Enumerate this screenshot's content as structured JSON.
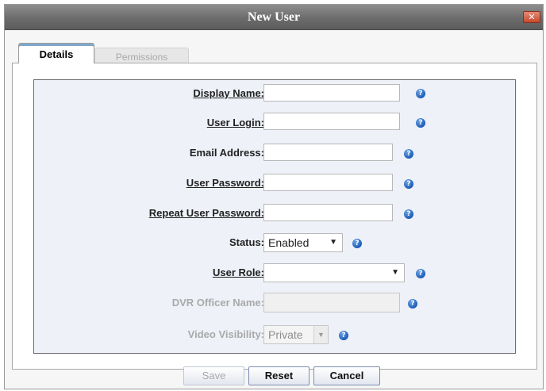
{
  "dialog": {
    "title": "New User",
    "close_glyph": "✕"
  },
  "tabs": [
    {
      "label": "Details",
      "active": true
    },
    {
      "label": "Permissions",
      "active": false
    }
  ],
  "form": {
    "display_name": {
      "label": "Display Name:",
      "value": ""
    },
    "user_login": {
      "label": "User Login:",
      "value": ""
    },
    "email_address": {
      "label": "Email Address:",
      "value": ""
    },
    "user_password": {
      "label": "User Password:",
      "value": ""
    },
    "repeat_password": {
      "label": "Repeat User Password:",
      "value": ""
    },
    "status": {
      "label": "Status:",
      "selected": "Enabled"
    },
    "user_role": {
      "label": "User Role:",
      "selected": ""
    },
    "dvr_officer_name": {
      "label": "DVR Officer Name:",
      "value": ""
    },
    "video_visibility": {
      "label": "Video Visibility:",
      "selected": "Private"
    }
  },
  "help_glyph": "?",
  "icons": {
    "help": "help-icon",
    "dropdown": "chevron-down-icon",
    "close": "close-icon"
  },
  "buttons": {
    "save": "Save",
    "reset": "Reset",
    "cancel": "Cancel"
  },
  "colors": {
    "title_bar": "#6c6c6c",
    "form_bg": "#eef1f8",
    "help_icon": "#1d5db7",
    "close": "#c64a2e"
  }
}
